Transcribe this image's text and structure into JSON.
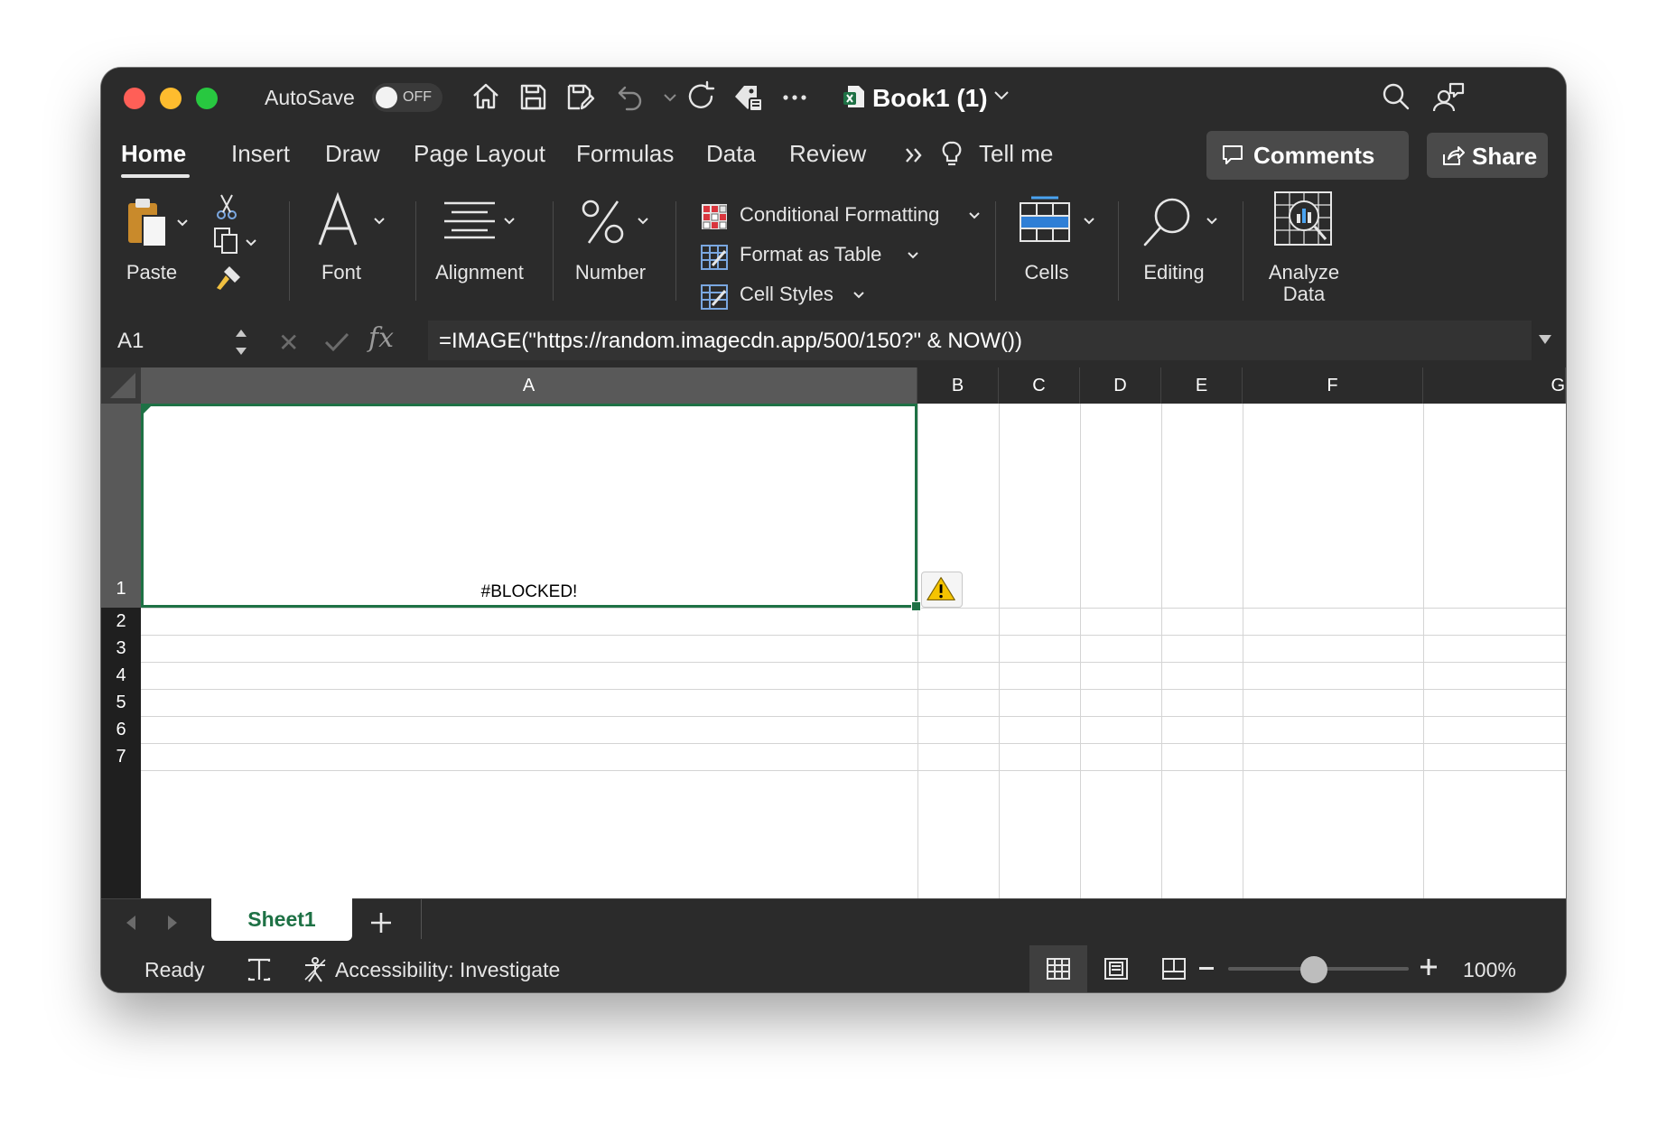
{
  "titlebar": {
    "autosave_label": "AutoSave",
    "autosave_state": "OFF",
    "document_title": "Book1 (1)"
  },
  "ribbon_tabs": [
    "Home",
    "Insert",
    "Draw",
    "Page Layout",
    "Formulas",
    "Data",
    "Review"
  ],
  "ribbon_more": "Tell me",
  "comments_label": "Comments",
  "share_label": "Share",
  "ribbon": {
    "paste": "Paste",
    "font": "Font",
    "alignment": "Alignment",
    "number": "Number",
    "conditional_formatting": "Conditional Formatting",
    "format_as_table": "Format as Table",
    "cell_styles": "Cell Styles",
    "cells": "Cells",
    "editing": "Editing",
    "analyze_line1": "Analyze",
    "analyze_line2": "Data"
  },
  "formula_bar": {
    "name_box": "A1",
    "fx": "fx",
    "formula": "=IMAGE(\"https://random.imagecdn.app/500/150?\" & NOW())"
  },
  "columns": [
    "A",
    "B",
    "C",
    "D",
    "E",
    "F",
    "G"
  ],
  "rows": [
    "1",
    "2",
    "3",
    "4",
    "5",
    "6",
    "7"
  ],
  "cells": {
    "A1": "#BLOCKED!"
  },
  "sheets": [
    "Sheet1"
  ],
  "status": {
    "ready": "Ready",
    "accessibility": "Accessibility: Investigate",
    "zoom": "100%",
    "zoom_level": 1.0
  },
  "colors": {
    "accent_green": "#1e7145",
    "window_bg": "#2b2b2b"
  }
}
